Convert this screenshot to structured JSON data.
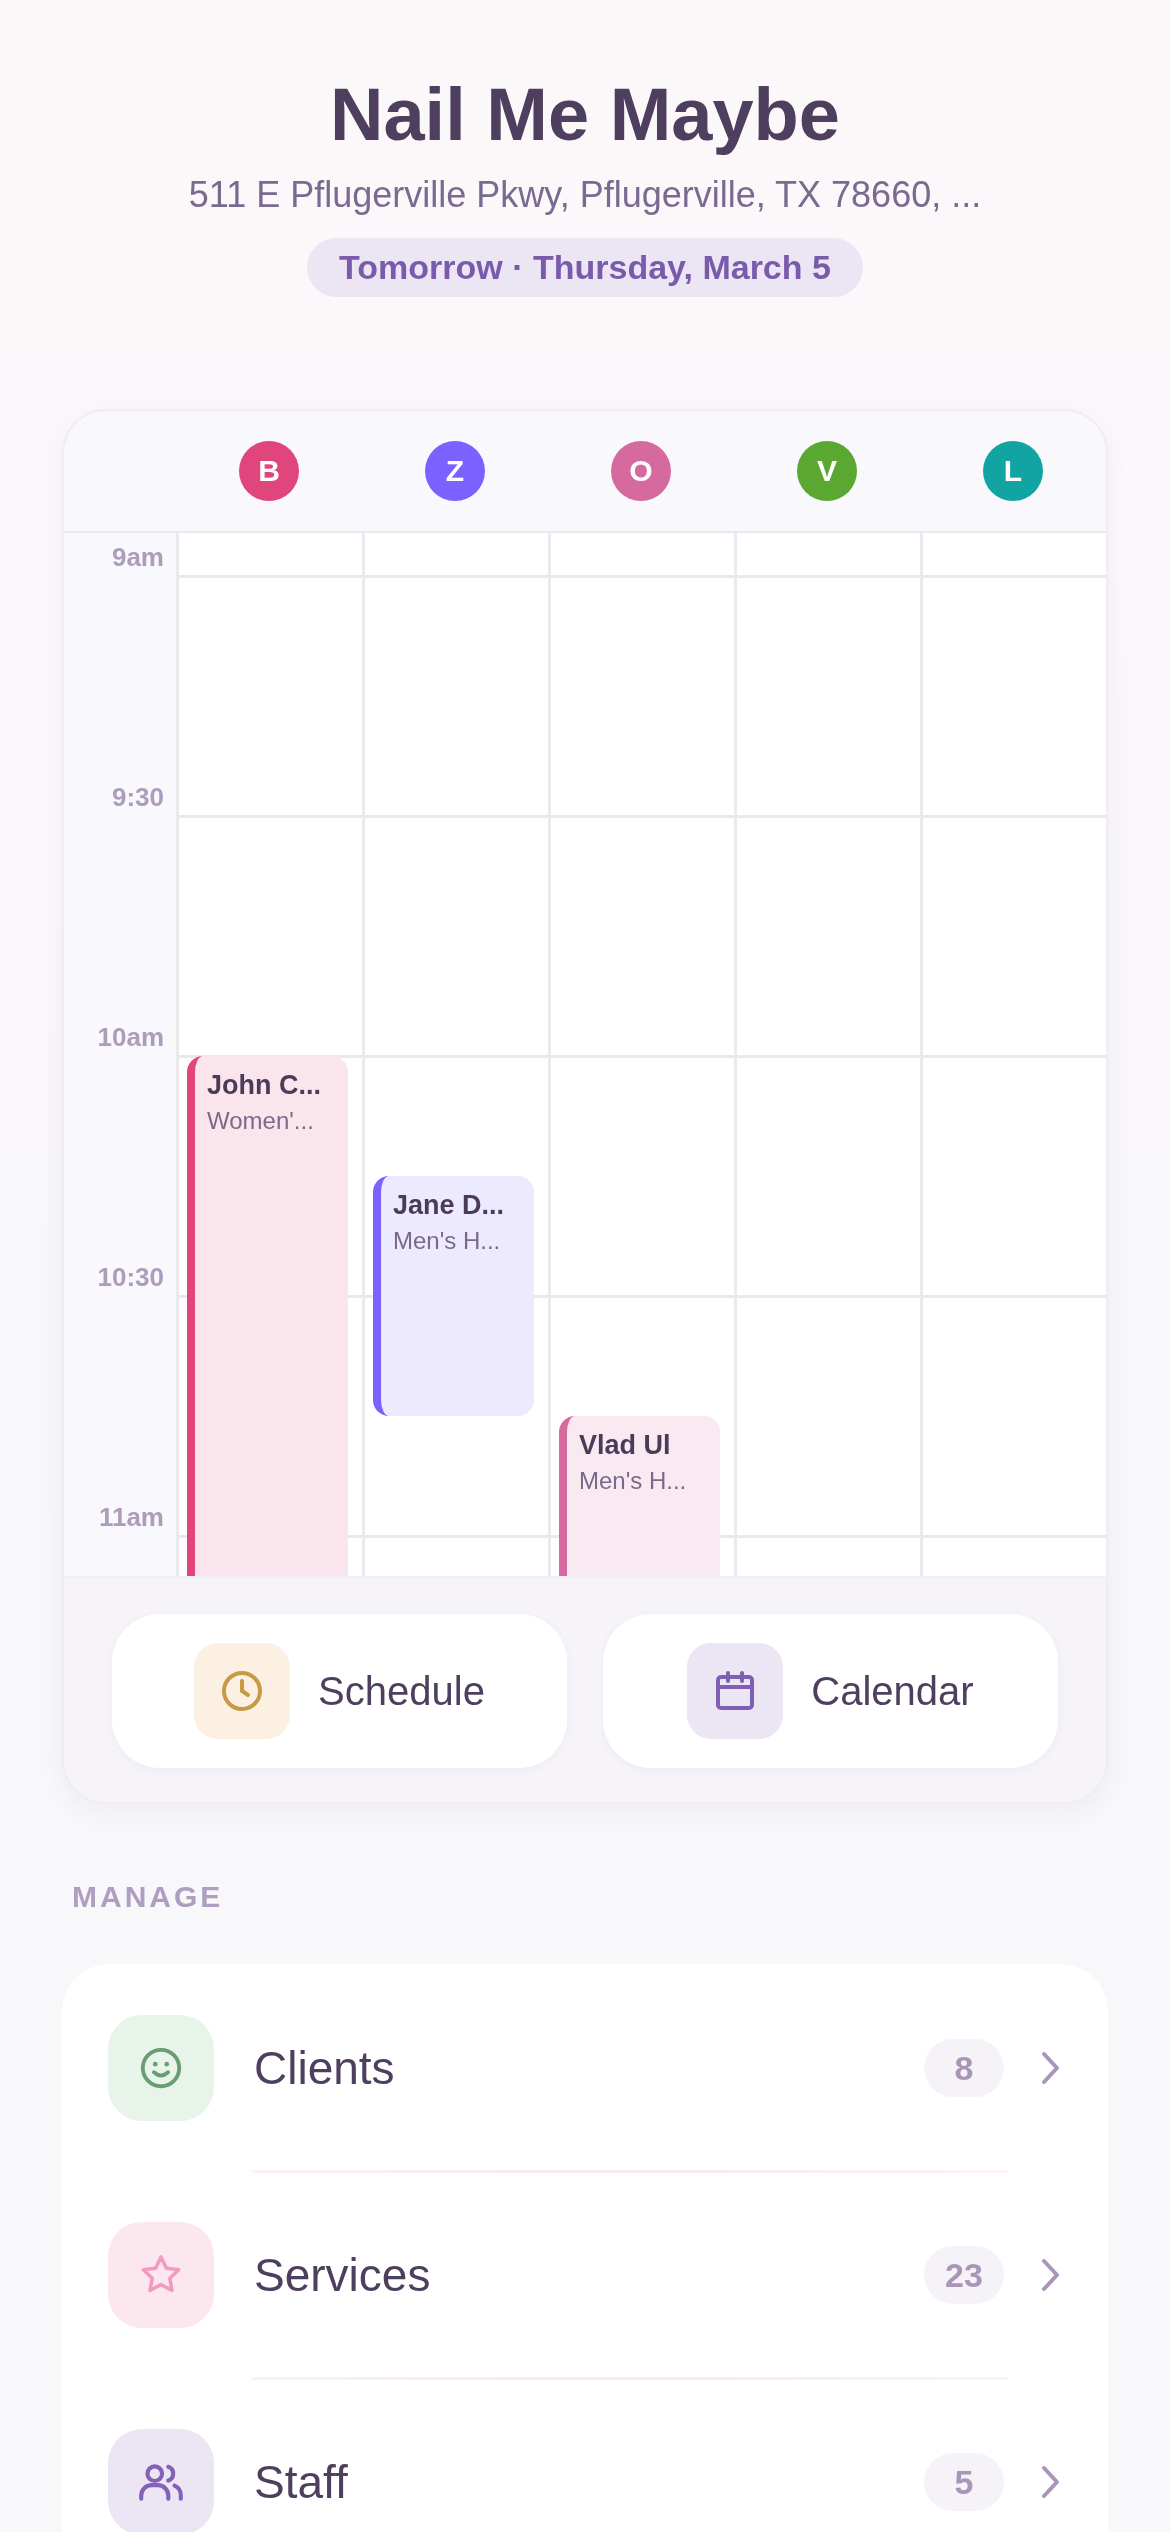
{
  "header": {
    "title": "Nail Me Maybe",
    "address": "511 E Pflugerville Pkwy, Pflugerville, TX 78660, ...",
    "date": "Tomorrow · Thursday, March 5"
  },
  "calendar": {
    "times": [
      "9am",
      "9:30",
      "10am",
      "10:30",
      "11am"
    ],
    "staff": [
      {
        "initial": "B",
        "color": "#e0457b",
        "appointments": [
          {
            "client": "John C...",
            "service": "Women'...",
            "color": "#e0457b"
          }
        ]
      },
      {
        "initial": "Z",
        "color": "#7b61ff",
        "appointments": [
          {
            "client": "Jane D...",
            "service": "Men's H...",
            "color": "#7b61ff"
          }
        ]
      },
      {
        "initial": "O",
        "color": "#d66a9f",
        "appointments": [
          {
            "client": "Vlad Ul",
            "service": "Men's H...",
            "color": "#d66a9f"
          }
        ]
      },
      {
        "initial": "V",
        "color": "#5aa832"
      },
      {
        "initial": "L",
        "color": "#12a3a3"
      }
    ],
    "actions": [
      {
        "kind": "schedule",
        "label": "Schedule"
      },
      {
        "kind": "calendar",
        "label": "Calendar"
      }
    ]
  },
  "manage": {
    "heading": "MANAGE",
    "items": [
      {
        "kind": "clients",
        "label": "Clients",
        "count": "8"
      },
      {
        "kind": "services",
        "label": "Services",
        "count": "23"
      },
      {
        "kind": "staff",
        "label": "Staff",
        "count": "5"
      }
    ]
  }
}
